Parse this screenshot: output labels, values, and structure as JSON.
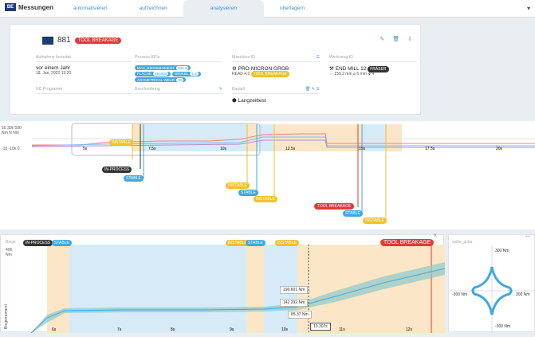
{
  "app": {
    "title": "Messungen"
  },
  "tabs": [
    {
      "label": "automatisieren"
    },
    {
      "label": "aufzeichnen"
    },
    {
      "label": "analysieren",
      "active": true
    },
    {
      "label": "überlagern"
    }
  ],
  "record": {
    "id": "881",
    "status": "TOOL BREAKAGE"
  },
  "fields": {
    "recording_ended": {
      "label": "Aufnahme beendet",
      "value": "vor einem Jahr",
      "sub": "18. Jan. 2022 15:20"
    },
    "nc_program": {
      "label": "NC Programm"
    },
    "process_kpis": {
      "label": "Prozess-KPIs",
      "items": [
        {
          "name": "MAX_BIEGEMOMENT",
          "value": "306.3"
        },
        {
          "name": "FLÄCHE",
          "value": "255850"
        },
        {
          "name": "WINKEL",
          "value": "1.5"
        },
        {
          "name": "ASYMETRICAL WEAR",
          "value": "93"
        }
      ]
    },
    "description": {
      "label": "Beschreibung"
    },
    "machine": {
      "label": "Maschine ID",
      "value": "PRO-MICRON GROB",
      "sub": "READ 4.0",
      "tag": "TOOL BREAKAGE"
    },
    "component": {
      "label": "Bauteil",
      "value": "Langzeittest"
    },
    "tool": {
      "label": "Werkzeug ID",
      "value": "END MILL 12",
      "tag": "FRÄSER",
      "length": "159.2 mm",
      "diameter": "6 mm",
      "flutes": "4"
    }
  },
  "timeline": {
    "ylabels": [
      "50\nNm",
      "30k\nN",
      "500\nNm",
      "-10",
      "-10k",
      "0"
    ],
    "ticks": [
      "5s",
      "7.5s",
      "10s",
      "12.5s",
      "15s",
      "17.5s",
      "20s"
    ],
    "events": [
      {
        "label": "INSTABLE",
        "color": "#f2c02b"
      },
      {
        "label": "IN-PROCESS",
        "color": "#333"
      },
      {
        "label": "STABLE",
        "color": "#3fa9e0"
      },
      {
        "label": "INSTABLE",
        "color": "#f2c02b"
      },
      {
        "label": "STABLE",
        "color": "#3fa9e0"
      },
      {
        "label": "INSTABLE",
        "color": "#f2c02b"
      },
      {
        "label": "TOOL BREAKAGE",
        "color": "#e53935"
      },
      {
        "label": "STABLE",
        "color": "#3fa9e0"
      },
      {
        "label": "INSTABLE",
        "color": "#f2c02b"
      }
    ]
  },
  "detail": {
    "title": "Biege",
    "badges": [
      {
        "label": "IN-PROCESS"
      },
      {
        "label": "STABLE"
      },
      {
        "label": "INSTABLE"
      },
      {
        "label": "STABLE"
      },
      {
        "label": "INSTABLE"
      },
      {
        "label": "TOOL BREAKAGE"
      }
    ],
    "ytop": "400\nNm",
    "ylabel": "Biegemoment",
    "ticks": [
      "6s",
      "7s",
      "8s",
      "9s",
      "10s",
      "11s",
      "12s"
    ],
    "tooltips": [
      "196.601 Nm",
      "142.292 Nm",
      "85.37 Nm"
    ],
    "cursor": "10.307s"
  },
  "polar": {
    "title": "spike_polar",
    "labels": [
      "300 Nm",
      "-300 Nm",
      "300 Nm",
      "-300 Nm"
    ]
  }
}
